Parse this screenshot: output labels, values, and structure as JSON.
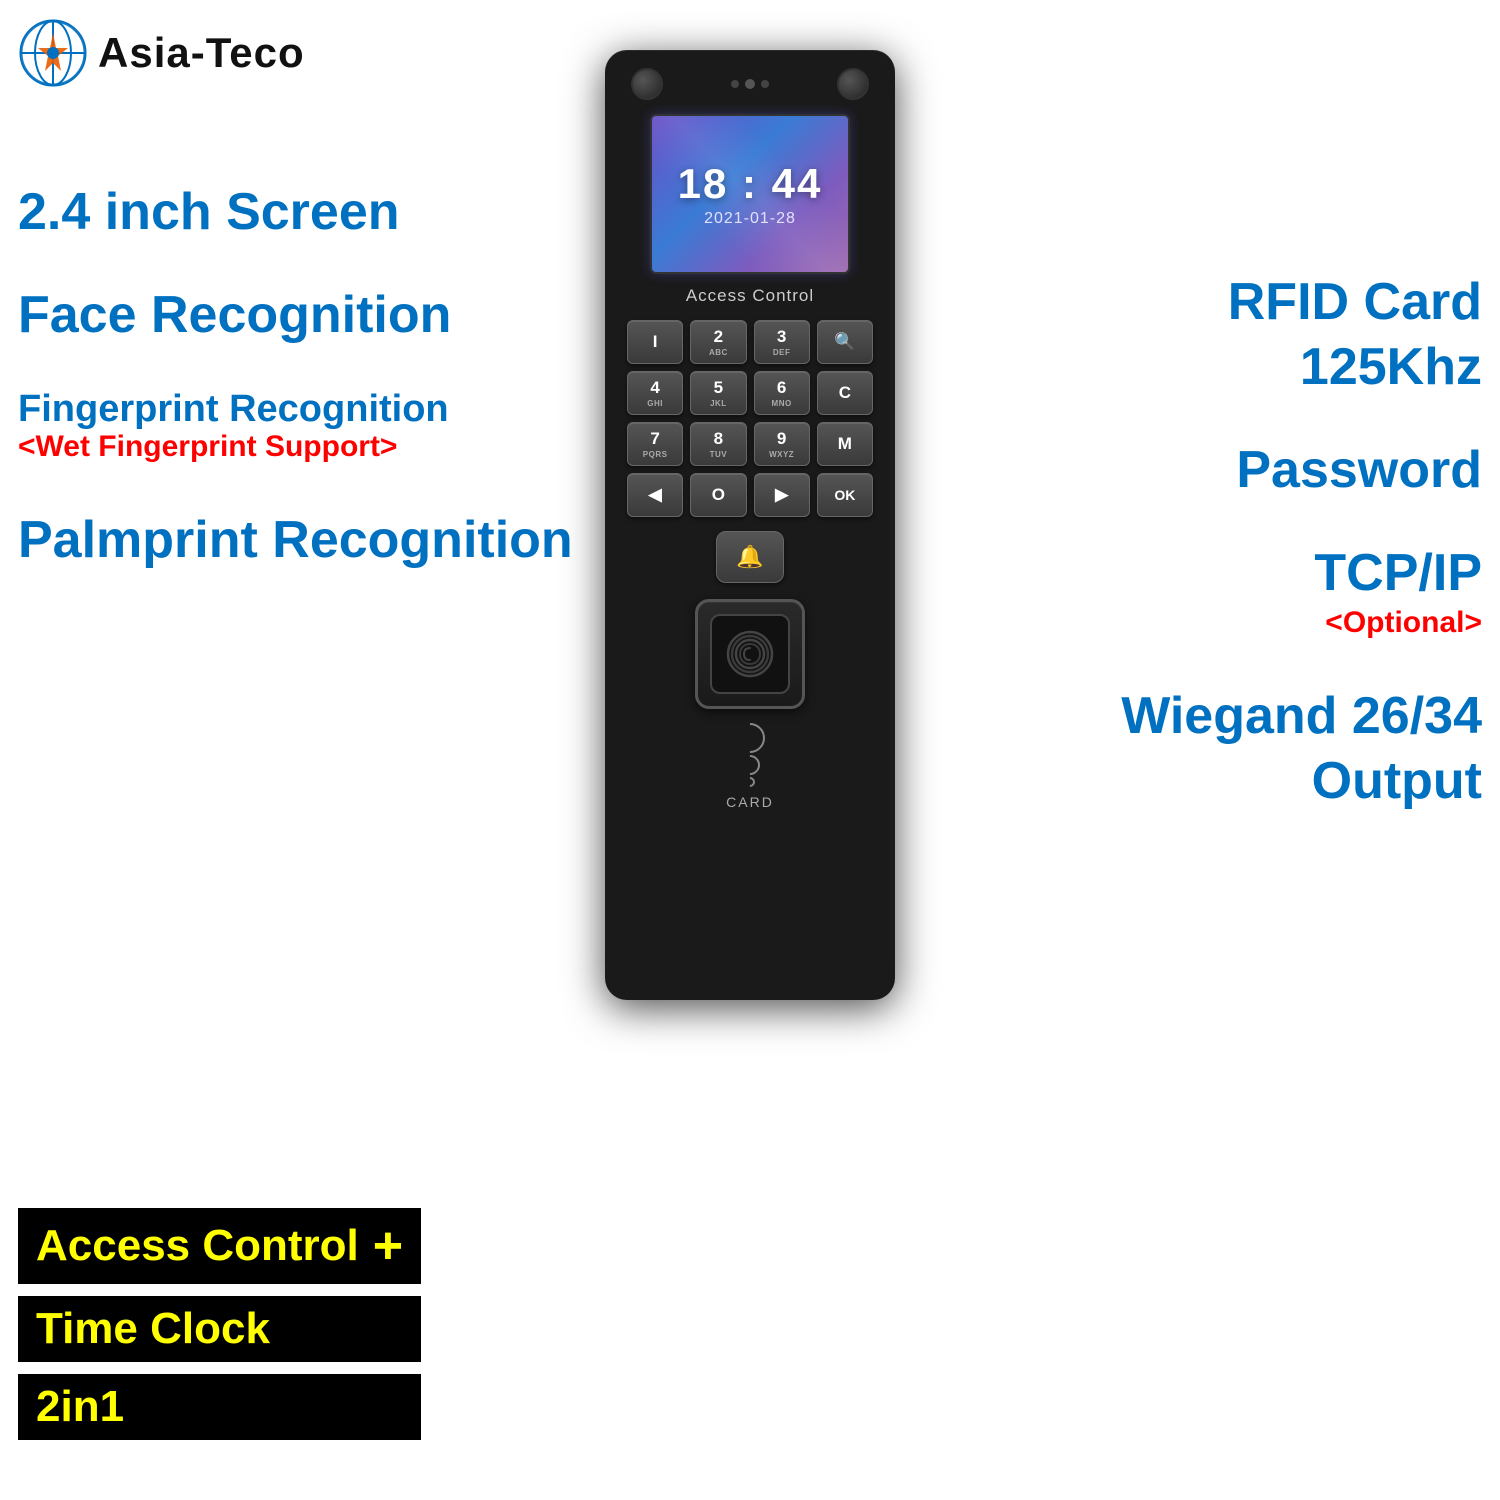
{
  "logo": {
    "text": "Asia-Teco"
  },
  "left": {
    "screen_label": "2.4 inch Screen",
    "face_label": "Face Recognition",
    "fingerprint_label": "Fingerprint  Recognition",
    "wet_label": "<Wet Fingerprint Support>",
    "palmprint_label": "Palmprint Recognition"
  },
  "right": {
    "rfid_label": "RFID Card",
    "freq_label": "125Khz",
    "password_label": "Password",
    "tcp_label": "TCP/IP",
    "optional_label": "<Optional>",
    "wiegand_label": "Wiegand 26/34",
    "output_label": "Output"
  },
  "labels": {
    "access_control": "Access Control",
    "plus": "+",
    "time_clock": "Time Clock",
    "twoin1": "2in1"
  },
  "device": {
    "time": "18 : 44",
    "date": "2021-01-28",
    "access_control": "Access Control",
    "card_label": "CARD",
    "keys": [
      {
        "main": "I",
        "sub": ""
      },
      {
        "main": "2",
        "sub": "ABC"
      },
      {
        "main": "3",
        "sub": "DEF"
      },
      {
        "main": "🔍",
        "sub": ""
      },
      {
        "main": "4",
        "sub": "GHI"
      },
      {
        "main": "5",
        "sub": "JKL"
      },
      {
        "main": "6",
        "sub": "MNO"
      },
      {
        "main": "C",
        "sub": ""
      },
      {
        "main": "7",
        "sub": "PQRS"
      },
      {
        "main": "8",
        "sub": "TUV"
      },
      {
        "main": "9",
        "sub": "WXYZ"
      },
      {
        "main": "M",
        "sub": ""
      },
      {
        "main": "◀",
        "sub": ""
      },
      {
        "main": "O",
        "sub": ""
      },
      {
        "main": "▶",
        "sub": ""
      },
      {
        "main": "OK",
        "sub": ""
      }
    ]
  }
}
